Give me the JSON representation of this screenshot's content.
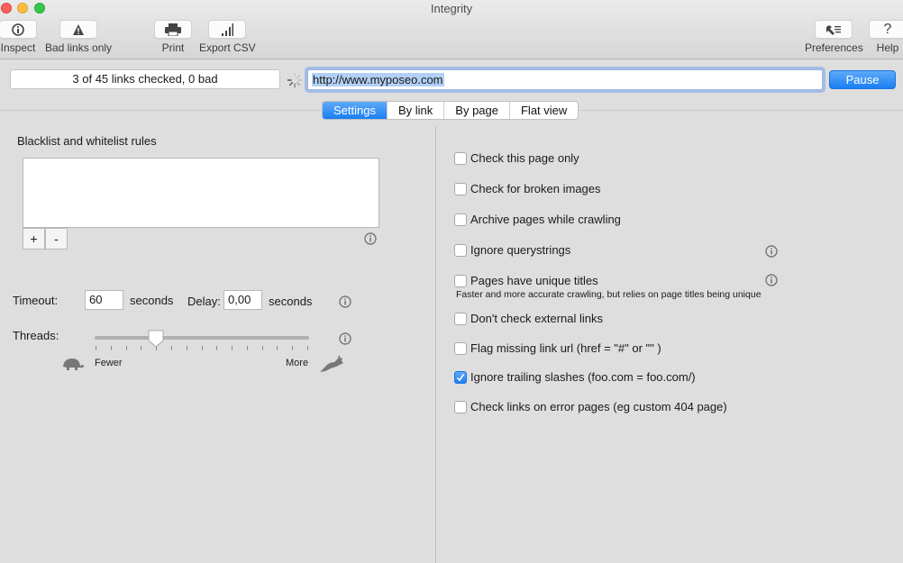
{
  "window": {
    "title": "Integrity",
    "traffic_lights": [
      "close",
      "minimize",
      "zoom"
    ]
  },
  "toolbar": {
    "items": [
      {
        "label": "Inspect",
        "icon": "info-circle-icon"
      },
      {
        "label": "Bad links only",
        "icon": "warning-triangle-icon"
      },
      {
        "label": "Print",
        "icon": "printer-icon"
      },
      {
        "label": "Export CSV",
        "icon": "bar-chart-icon"
      },
      {
        "label": "Preferences",
        "icon": "wrench-list-icon"
      },
      {
        "label": "Help",
        "icon": "question-mark-icon"
      }
    ]
  },
  "status": {
    "text": "3 of 45 links checked, 0 bad",
    "spinner": "activity-spinner-icon"
  },
  "url_field": {
    "value": "http://www.myposeo.com",
    "selected": true
  },
  "pause_button": {
    "label": "Pause"
  },
  "tabs": [
    {
      "label": "Settings",
      "active": true
    },
    {
      "label": "By link",
      "active": false
    },
    {
      "label": "By page",
      "active": false
    },
    {
      "label": "Flat view",
      "active": false
    }
  ],
  "settings": {
    "rules": {
      "title": "Blacklist and whitelist rules",
      "items": [],
      "add_label": "+",
      "remove_label": "-"
    },
    "timeout": {
      "label": "Timeout:",
      "value": "60",
      "unit": "seconds"
    },
    "delay": {
      "label": "Delay:",
      "value": "0,00",
      "unit": "seconds"
    },
    "threads": {
      "label": "Threads:",
      "min_label": "Fewer",
      "max_label": "More",
      "tick_count": 15,
      "value_tick_index": 4
    },
    "options": [
      {
        "label": "Check this page only",
        "checked": false,
        "info": false
      },
      {
        "label": "Check for broken images",
        "checked": false,
        "info": false
      },
      {
        "label": "Archive pages while crawling",
        "checked": false,
        "info": false
      },
      {
        "label": "Ignore querystrings",
        "checked": false,
        "info": true
      },
      {
        "label": "Pages have unique titles",
        "checked": false,
        "info": true,
        "note": "Faster and more accurate crawling, but relies on page titles being unique"
      },
      {
        "label": "Don't check external links",
        "checked": false,
        "info": false
      },
      {
        "label": "Flag missing link url (href = \"#\"  or  \"\" )",
        "checked": false,
        "info": false
      },
      {
        "label": "Ignore trailing slashes (foo.com = foo.com/)",
        "checked": true,
        "info": false
      },
      {
        "label": "Check links on error pages (eg custom 404 page)",
        "checked": false,
        "info": false
      }
    ]
  },
  "colors": {
    "accent": "#1a7ff2",
    "selection": "#b2d0f6",
    "panel_bg": "#dedede"
  }
}
